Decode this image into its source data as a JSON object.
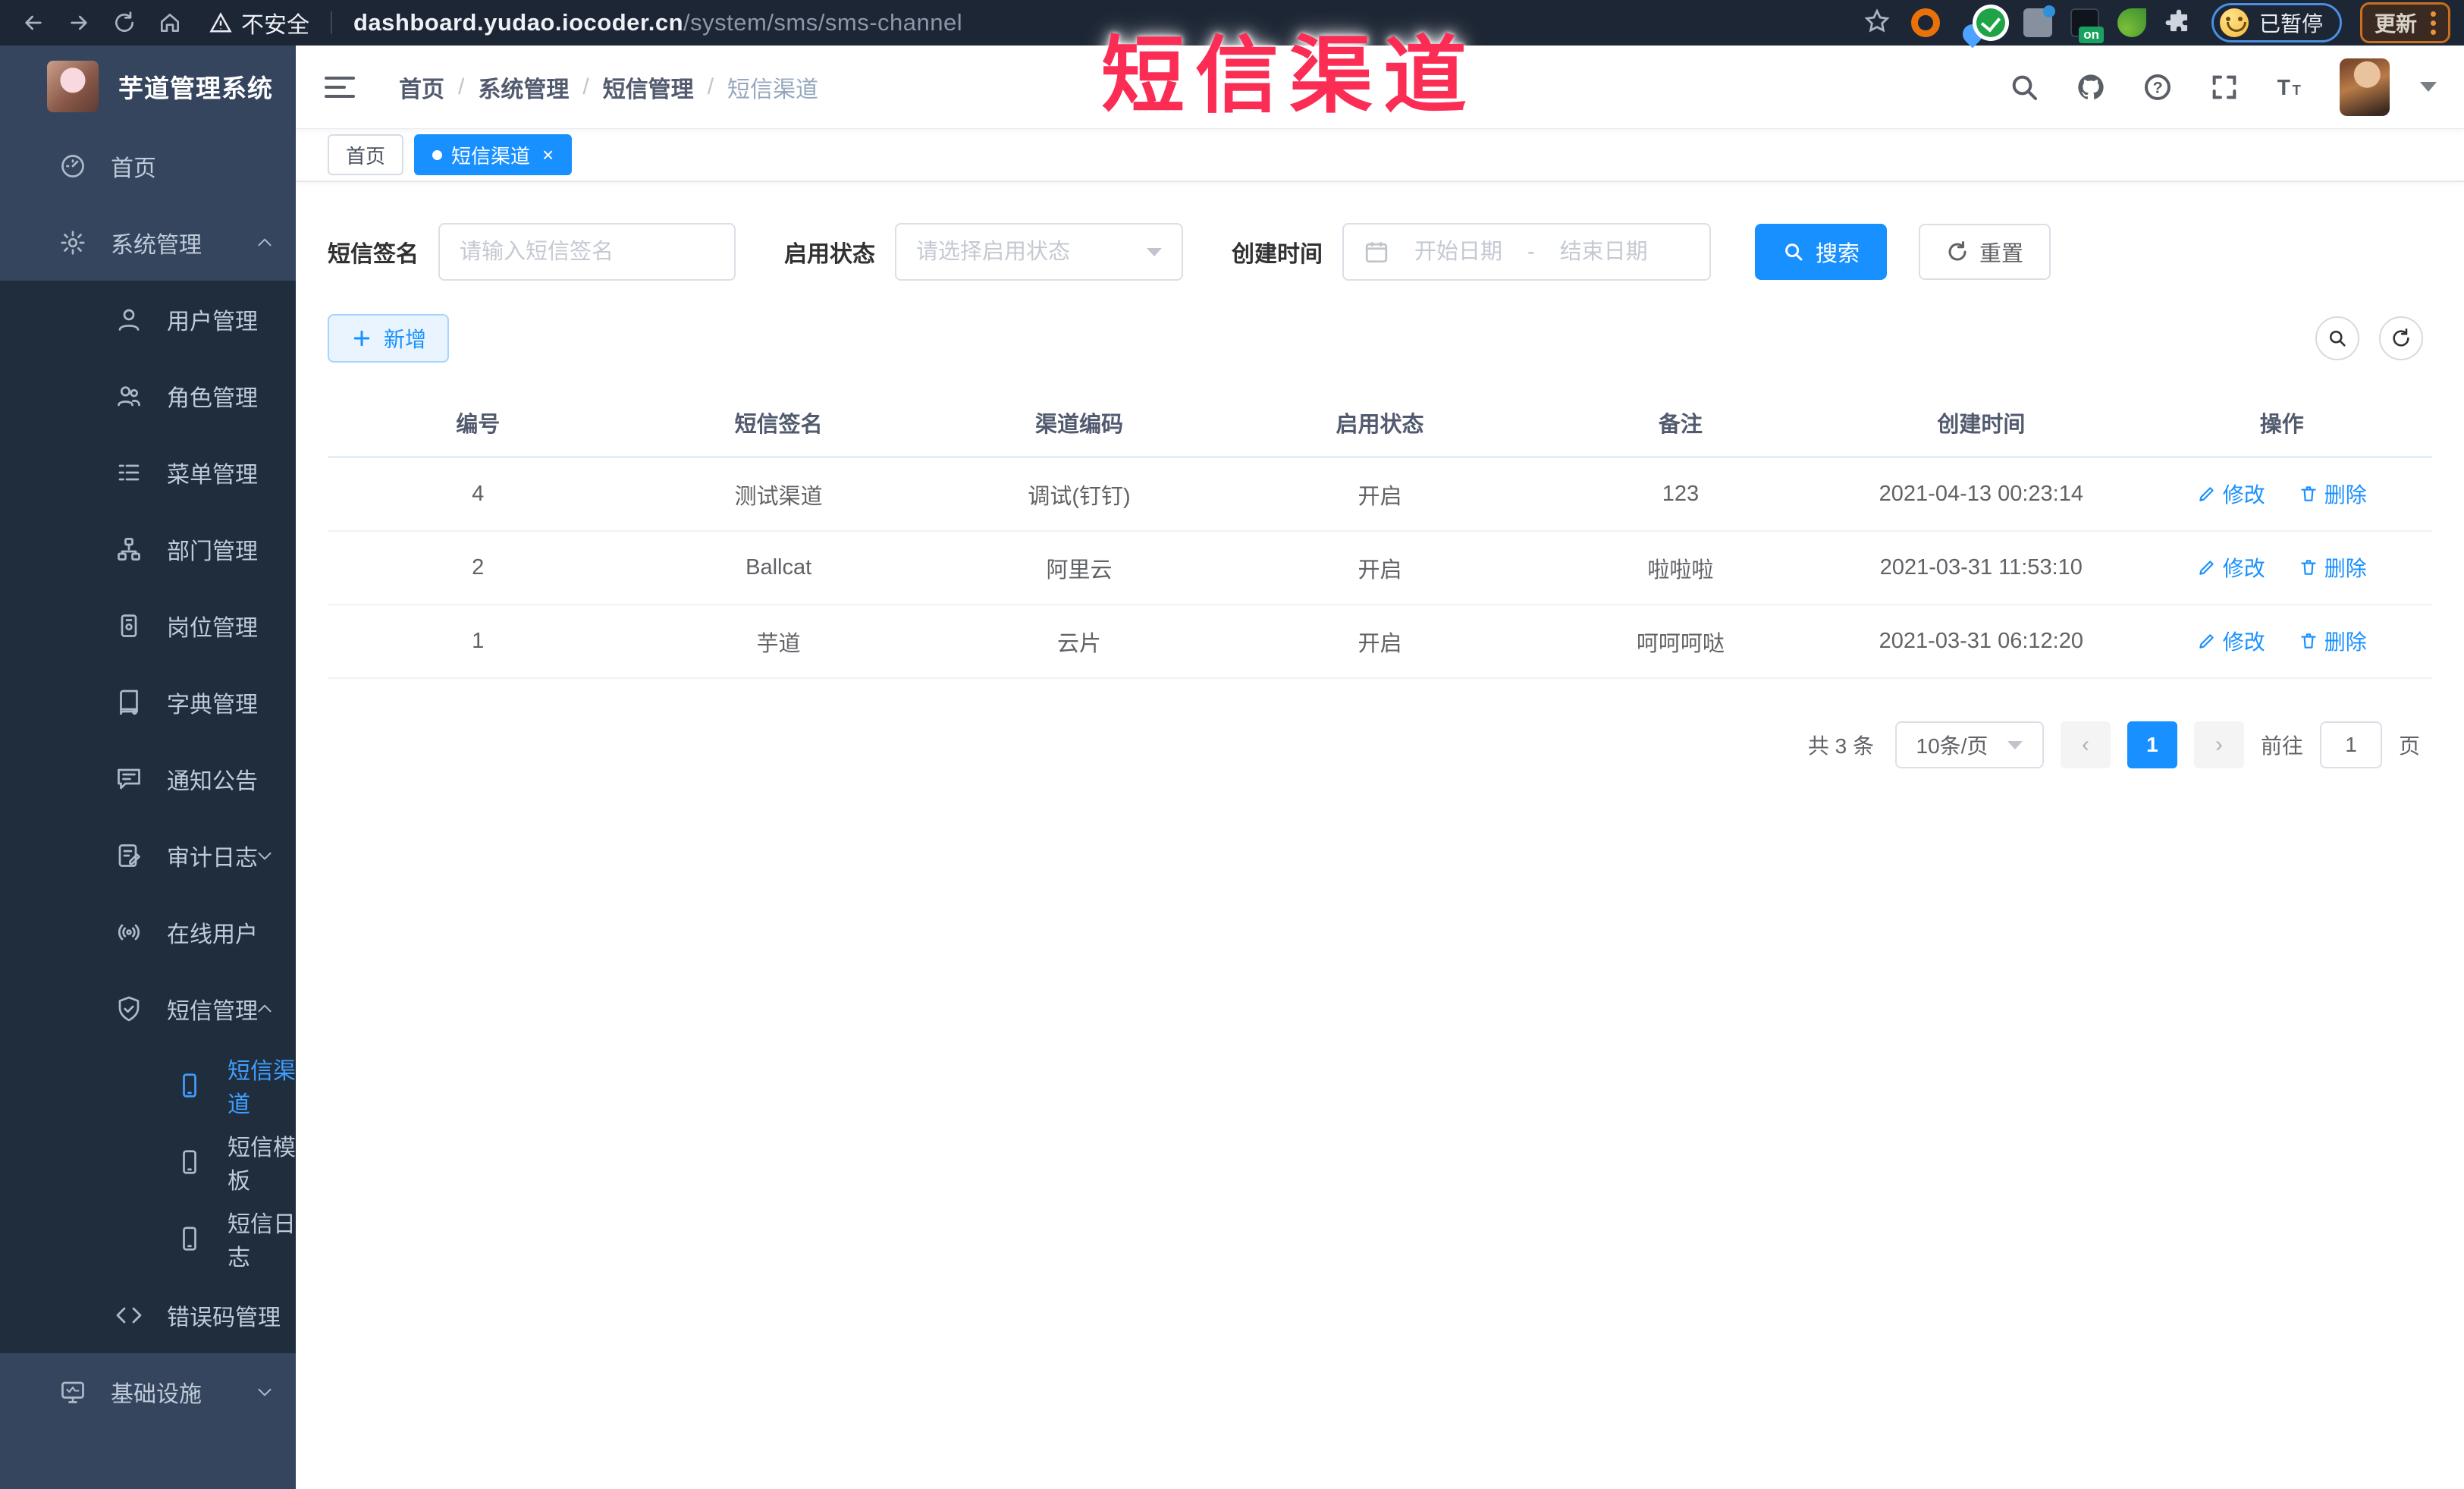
{
  "overlay_title": "短信渠道",
  "browser": {
    "security_label": "不安全",
    "url_host": "dashboard.yudao.iocoder.cn",
    "url_path": "/system/sms/sms-channel",
    "ext_on_badge": "on",
    "paused_label": "已暂停",
    "update_label": "更新"
  },
  "sidebar": {
    "logo_title": "芋道管理系统",
    "items": [
      {
        "label": "首页"
      },
      {
        "label": "系统管理"
      },
      {
        "label": "用户管理"
      },
      {
        "label": "角色管理"
      },
      {
        "label": "菜单管理"
      },
      {
        "label": "部门管理"
      },
      {
        "label": "岗位管理"
      },
      {
        "label": "字典管理"
      },
      {
        "label": "通知公告"
      },
      {
        "label": "审计日志"
      },
      {
        "label": "在线用户"
      },
      {
        "label": "短信管理"
      },
      {
        "label": "短信渠道"
      },
      {
        "label": "短信模板"
      },
      {
        "label": "短信日志"
      },
      {
        "label": "错误码管理"
      },
      {
        "label": "基础设施"
      }
    ]
  },
  "breadcrumb": [
    "首页",
    "系统管理",
    "短信管理",
    "短信渠道"
  ],
  "tabs": {
    "home": "首页",
    "current": "短信渠道",
    "close": "×"
  },
  "filters": {
    "sign_label": "短信签名",
    "sign_placeholder": "请输入短信签名",
    "status_label": "启用状态",
    "status_placeholder": "请选择启用状态",
    "time_label": "创建时间",
    "start_placeholder": "开始日期",
    "range_separator": "-",
    "end_placeholder": "结束日期",
    "search_label": "搜索",
    "reset_label": "重置"
  },
  "toolbar": {
    "add_label": "新增"
  },
  "table": {
    "headers": [
      "编号",
      "短信签名",
      "渠道编码",
      "启用状态",
      "备注",
      "创建时间",
      "操作"
    ],
    "edit_label": "修改",
    "delete_label": "删除",
    "rows": [
      {
        "id": "4",
        "sign": "测试渠道",
        "code": "调试(钉钉)",
        "status": "开启",
        "remark": "123",
        "created": "2021-04-13 00:23:14"
      },
      {
        "id": "2",
        "sign": "Ballcat",
        "code": "阿里云",
        "status": "开启",
        "remark": "啦啦啦",
        "created": "2021-03-31 11:53:10"
      },
      {
        "id": "1",
        "sign": "芋道",
        "code": "云片",
        "status": "开启",
        "remark": "呵呵呵哒",
        "created": "2021-03-31 06:12:20"
      }
    ]
  },
  "pagination": {
    "total_label": "共 3 条",
    "page_size_label": "10条/页",
    "prev": "‹",
    "current_page": "1",
    "next": "›",
    "goto_label": "前往",
    "goto_value": "1",
    "page_unit": "页"
  },
  "colors": {
    "accent": "#1890ff",
    "sidebar_bg": "#304156",
    "submenu_bg": "#1f2d3d",
    "annotation_red": "#fb2d55"
  }
}
